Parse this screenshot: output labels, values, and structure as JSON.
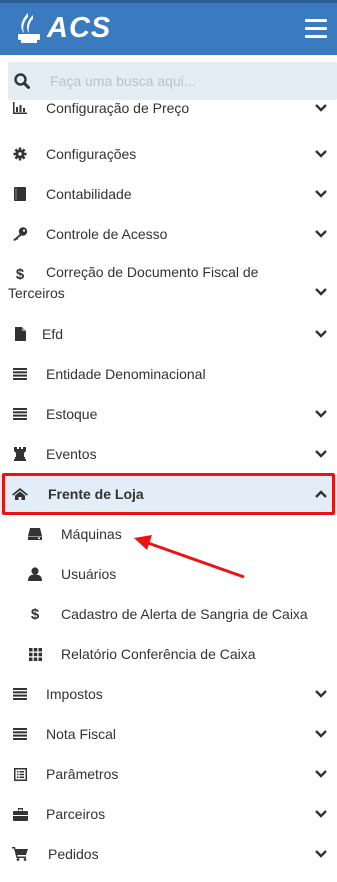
{
  "app": {
    "logo_text": "ACS"
  },
  "search": {
    "placeholder": "Faça uma busca aqui..."
  },
  "menu": {
    "items": [
      {
        "label": "Configuração de Preço",
        "icon": "bar-chart-icon",
        "has_chevron": true
      },
      {
        "label": "Configurações",
        "icon": "gear-icon",
        "has_chevron": true
      },
      {
        "label": "Contabilidade",
        "icon": "book-icon",
        "has_chevron": true
      },
      {
        "label": "Controle de Acesso",
        "icon": "key-icon",
        "has_chevron": true
      },
      {
        "label": "Correção de Documento Fiscal de Terceiros",
        "icon": "dollar-icon",
        "has_chevron": true
      },
      {
        "label": "Efd",
        "icon": "file-icon",
        "has_chevron": true
      },
      {
        "label": "Entidade Denominacional",
        "icon": "list-icon",
        "has_chevron": false
      },
      {
        "label": "Estoque",
        "icon": "list-icon",
        "has_chevron": true
      },
      {
        "label": "Eventos",
        "icon": "rook-icon",
        "has_chevron": true
      },
      {
        "label": "Frente de Loja",
        "icon": "home-icon",
        "has_chevron": true,
        "expanded": true
      },
      {
        "label": "Impostos",
        "icon": "list-icon",
        "has_chevron": true
      },
      {
        "label": "Nota Fiscal",
        "icon": "list-icon",
        "has_chevron": true
      },
      {
        "label": "Parâmetros",
        "icon": "list-alt-icon",
        "has_chevron": true
      },
      {
        "label": "Parceiros",
        "icon": "briefcase-icon",
        "has_chevron": true
      },
      {
        "label": "Pedidos",
        "icon": "cart-icon",
        "has_chevron": true
      }
    ],
    "frente_de_loja_children": [
      {
        "label": "Máquinas",
        "icon": "hdd-icon"
      },
      {
        "label": "Usuários",
        "icon": "user-icon"
      },
      {
        "label": "Cadastro de Alerta de Sangria de Caixa",
        "icon": "dollar-icon"
      },
      {
        "label": "Relatório Conferência de Caixa",
        "icon": "grid-icon"
      }
    ]
  },
  "colors": {
    "header": "#3a7bbf",
    "active_bg": "#e2edf7",
    "highlight": "#e11111",
    "icon": "#333333"
  }
}
